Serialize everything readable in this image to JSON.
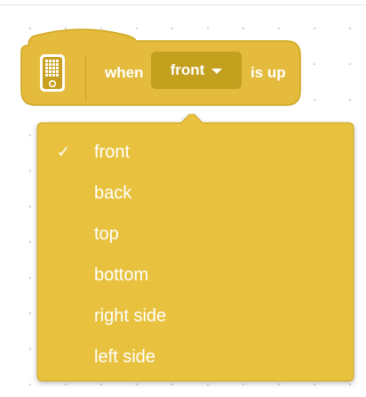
{
  "colors": {
    "block_fill": "#e5bb3d",
    "block_stroke": "#cfa61c",
    "field_fill": "#c4a01f",
    "dropdown_fill": "#e8c23f",
    "text": "#ffffff"
  },
  "block": {
    "icon": "hub-device-icon",
    "when_label": "when",
    "selected_value": "front",
    "dropdown_arrow_icon": "caret-down-icon",
    "is_up_label": "is up"
  },
  "dropdown": {
    "selected_index": 0,
    "check_icon": "checkmark-icon",
    "check_glyph": "✓",
    "items": [
      {
        "label": "front"
      },
      {
        "label": "back"
      },
      {
        "label": "top"
      },
      {
        "label": "bottom"
      },
      {
        "label": "right side"
      },
      {
        "label": "left side"
      }
    ]
  }
}
